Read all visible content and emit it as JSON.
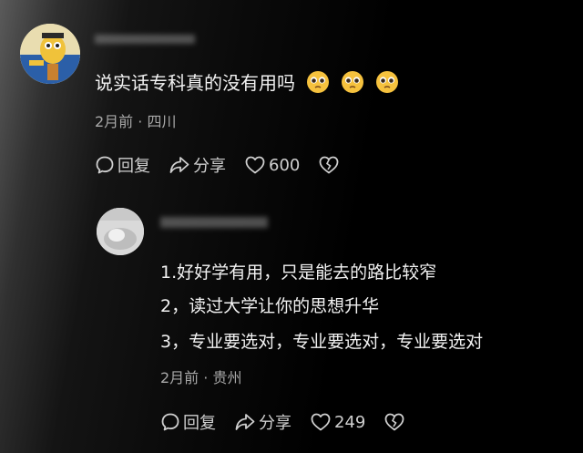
{
  "comment": {
    "text": "说实话专科真的没有用吗",
    "emojis": [
      "pleading-face-icon",
      "pleading-face-icon",
      "pleading-face-icon"
    ],
    "meta": "2月前 · 四川",
    "actions": {
      "reply": "回复",
      "share": "分享",
      "likes": "600"
    }
  },
  "reply": {
    "lines": [
      "1.好好学有用，只是能去的路比较窄",
      "2，读过大学让你的思想升华",
      "3，专业要选对，专业要选对，专业要选对"
    ],
    "meta": "2月前 · 贵州",
    "actions": {
      "reply": "回复",
      "share": "分享",
      "likes": "249"
    }
  }
}
